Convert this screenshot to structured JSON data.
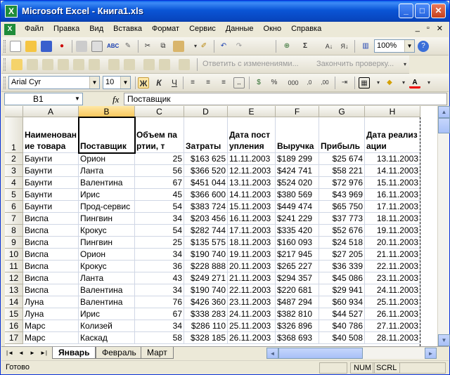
{
  "window": {
    "title": "Microsoft Excel - Книга1.xls",
    "app_icon_text": "X",
    "controls": {
      "minimize": "_",
      "maximize": "□",
      "close": "✕"
    }
  },
  "menu": {
    "items": [
      "Файл",
      "Правка",
      "Вид",
      "Вставка",
      "Формат",
      "Сервис",
      "Данные",
      "Окно",
      "Справка"
    ],
    "doc_controls": [
      "_",
      "▫",
      "✕"
    ]
  },
  "toolbar_standard": {
    "zoom": "100%",
    "icons": [
      "new-icon",
      "open-icon",
      "save-icon",
      "permission-icon",
      "print-icon",
      "print-preview-icon",
      "spelling-icon",
      "research-icon",
      "cut-icon",
      "copy-icon",
      "paste-icon",
      "format-painter-icon",
      "undo-icon",
      "redo-icon",
      "hyperlink-icon",
      "autosum-icon",
      "sort-ascending-icon",
      "sort-descending-icon",
      "chart-wizard-icon",
      "help-icon"
    ]
  },
  "toolbar_reviewing": {
    "reply_label": "Ответить с изменениями...",
    "end_review_label": "Закончить проверку..."
  },
  "toolbar_formatting": {
    "font": "Arial Cyr",
    "size": "10",
    "bold": "Ж",
    "italic": "К",
    "underline": "Ч",
    "percent": "%",
    "thousands": "000"
  },
  "formula_bar": {
    "name_box": "B1",
    "fx": "fx",
    "value": "Поставщик"
  },
  "sheet": {
    "columns": [
      "A",
      "B",
      "C",
      "D",
      "E",
      "F",
      "G",
      "H"
    ],
    "selected_column": "B",
    "header_row": [
      "Наименование товара",
      "Поставщик",
      "Объем партии, т",
      "Затраты",
      "Дата поступления",
      "Выручка",
      "Прибыль",
      "Дата реализации"
    ],
    "rows": [
      [
        "2",
        "Баунти",
        "Орион",
        "25",
        "$163 625",
        "11.11.2003",
        "$189 299",
        "$25 674",
        "13.11.2003"
      ],
      [
        "3",
        "Баунти",
        "Ланта",
        "56",
        "$366 520",
        "12.11.2003",
        "$424 741",
        "$58 221",
        "14.11.2003"
      ],
      [
        "4",
        "Баунти",
        "Валентина",
        "67",
        "$451 044",
        "13.11.2003",
        "$524 020",
        "$72 976",
        "15.11.2003"
      ],
      [
        "5",
        "Баунти",
        "Ирис",
        "45",
        "$366 600",
        "14.11.2003",
        "$380 569",
        "$43 969",
        "16.11.2003"
      ],
      [
        "6",
        "Баунти",
        "Прод-сервис",
        "54",
        "$383 724",
        "15.11.2003",
        "$449 474",
        "$65 750",
        "17.11.2003"
      ],
      [
        "7",
        "Виспа",
        "Пингвин",
        "34",
        "$203 456",
        "16.11.2003",
        "$241 229",
        "$37 773",
        "18.11.2003"
      ],
      [
        "8",
        "Виспа",
        "Крокус",
        "54",
        "$282 744",
        "17.11.2003",
        "$335 420",
        "$52 676",
        "19.11.2003"
      ],
      [
        "9",
        "Виспа",
        "Пингвин",
        "25",
        "$135 575",
        "18.11.2003",
        "$160 093",
        "$24 518",
        "20.11.2003"
      ],
      [
        "10",
        "Виспа",
        "Орион",
        "34",
        "$190 740",
        "19.11.2003",
        "$217 945",
        "$27 205",
        "21.11.2003"
      ],
      [
        "11",
        "Виспа",
        "Крокус",
        "36",
        "$228 888",
        "20.11.2003",
        "$265 227",
        "$36 339",
        "22.11.2003"
      ],
      [
        "12",
        "Виспа",
        "Ланта",
        "43",
        "$249 271",
        "21.11.2003",
        "$294 357",
        "$45 086",
        "23.11.2003"
      ],
      [
        "13",
        "Виспа",
        "Валентина",
        "34",
        "$190 740",
        "22.11.2003",
        "$220 681",
        "$29 941",
        "24.11.2003"
      ],
      [
        "14",
        "Луна",
        "Валентина",
        "76",
        "$426 360",
        "23.11.2003",
        "$487 294",
        "$60 934",
        "25.11.2003"
      ],
      [
        "15",
        "Луна",
        "Ирис",
        "67",
        "$338 283",
        "24.11.2003",
        "$382 810",
        "$44 527",
        "26.11.2003"
      ],
      [
        "16",
        "Марс",
        "Колизей",
        "34",
        "$286 110",
        "25.11.2003",
        "$326 896",
        "$40 786",
        "27.11.2003"
      ],
      [
        "17",
        "Марс",
        "Каскад",
        "58",
        "$328 185",
        "26.11.2003",
        "$368 693",
        "$40 508",
        "28.11.2003"
      ]
    ]
  },
  "tabs": {
    "nav": [
      "|◄",
      "◄",
      "►",
      "►|"
    ],
    "sheets": [
      "Январь",
      "Февраль",
      "Март"
    ],
    "active": "Январь"
  },
  "status": {
    "ready": "Готово",
    "num": "NUM",
    "scrl": "SCRL"
  }
}
